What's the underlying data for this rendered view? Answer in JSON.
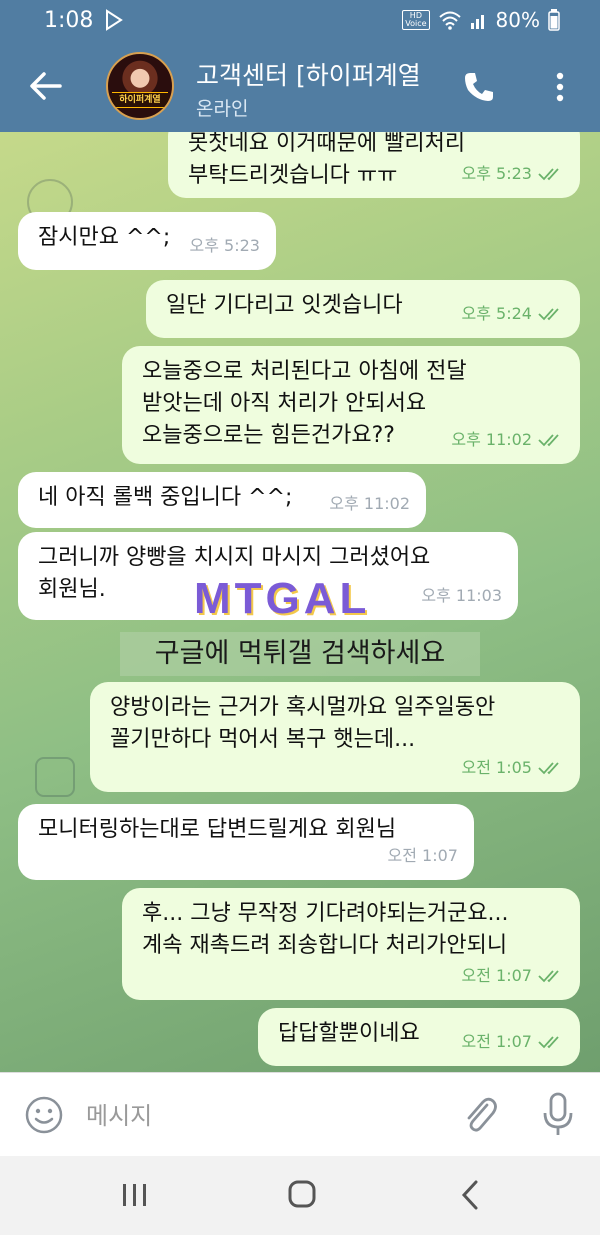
{
  "status_bar": {
    "time": "1:08",
    "hd_label": "HD",
    "voice_label": "Voice",
    "battery": "80%"
  },
  "header": {
    "title": "고객센터 [하이퍼계열",
    "status": "온라인",
    "avatar_badge": "하이퍼계열",
    "icons": [
      "arrow-left-icon",
      "phone-icon",
      "more-vert-icon"
    ]
  },
  "messages": [
    {
      "dir": "out",
      "text": "못찻네요 이거때문에 빨리처리\n부탁드리겟습니다 ㅠㅠ",
      "time": "오후 5:23",
      "read": true
    },
    {
      "dir": "in",
      "text": "잠시만요 ^^;",
      "time": "오후 5:23"
    },
    {
      "dir": "out",
      "text": "일단 기다리고 잇겟습니다",
      "time": "오후 5:24",
      "read": true
    },
    {
      "dir": "out",
      "text": "오늘중으로 처리된다고 아침에 전달\n받앗는데 아직 처리가 안되서요\n오늘중으로는 힘든건가요??",
      "time": "오후 11:02",
      "read": true
    },
    {
      "dir": "in",
      "text": "네 아직 롤백 중입니다 ^^;",
      "time": "오후 11:02"
    },
    {
      "dir": "in",
      "text": "그러니까 양빵을 치시지 마시지 그러셨어요\n회원님.",
      "time": "오후 11:03"
    },
    {
      "dir": "out",
      "text": "양방이라는 근거가 혹시멀까요 일주일동안\n꼴기만하다 먹어서 복구 햇는데...",
      "time": "오전 1:05",
      "read": true
    },
    {
      "dir": "in",
      "text": "모니터링하는대로 답변드릴게요 회원님",
      "time": "오전 1:07"
    },
    {
      "dir": "out",
      "text": "후... 그냥 무작정 기다려야되는거군요...\n계속 재촉드려 죄송합니다 처리가안되니",
      "time": "오전 1:07",
      "read": true
    },
    {
      "dir": "out",
      "text": "답답할뿐이네요",
      "time": "오전 1:07",
      "read": true
    }
  ],
  "watermark": {
    "logo_text": "MTGAL",
    "caption": "구글에 먹튀갤 검색하세요"
  },
  "input_bar": {
    "placeholder": "메시지",
    "icons": [
      "emoji-icon",
      "paperclip-icon",
      "microphone-icon"
    ]
  },
  "nav_bar": {
    "icons": [
      "recent-apps-icon",
      "home-icon",
      "back-icon"
    ]
  },
  "colors": {
    "header_bg": "#517da2",
    "incoming_bubble": "#ffffff",
    "outgoing_bubble": "#effdde",
    "outgoing_meta": "#6ab26a"
  }
}
